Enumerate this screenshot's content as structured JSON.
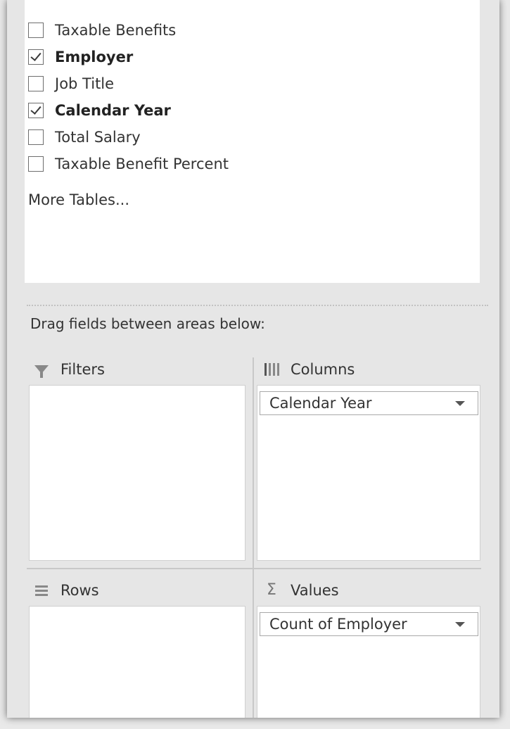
{
  "fields": [
    {
      "label": "Taxable Benefits",
      "checked": false
    },
    {
      "label": "Employer",
      "checked": true
    },
    {
      "label": "Job Title",
      "checked": false
    },
    {
      "label": "Calendar Year",
      "checked": true
    },
    {
      "label": "Total Salary",
      "checked": false
    },
    {
      "label": "Taxable Benefit Percent",
      "checked": false
    }
  ],
  "more_tables": "More Tables...",
  "drag_hint": "Drag fields between areas below:",
  "areas": {
    "filters": {
      "label": "Filters",
      "icon": "filter-icon",
      "items": []
    },
    "columns": {
      "label": "Columns",
      "icon": "columns-icon",
      "items": [
        "Calendar Year"
      ]
    },
    "rows": {
      "label": "Rows",
      "icon": "rows-icon",
      "items": []
    },
    "values": {
      "label": "Values",
      "icon": "sigma-icon",
      "items": [
        "Count of Employer"
      ]
    }
  }
}
